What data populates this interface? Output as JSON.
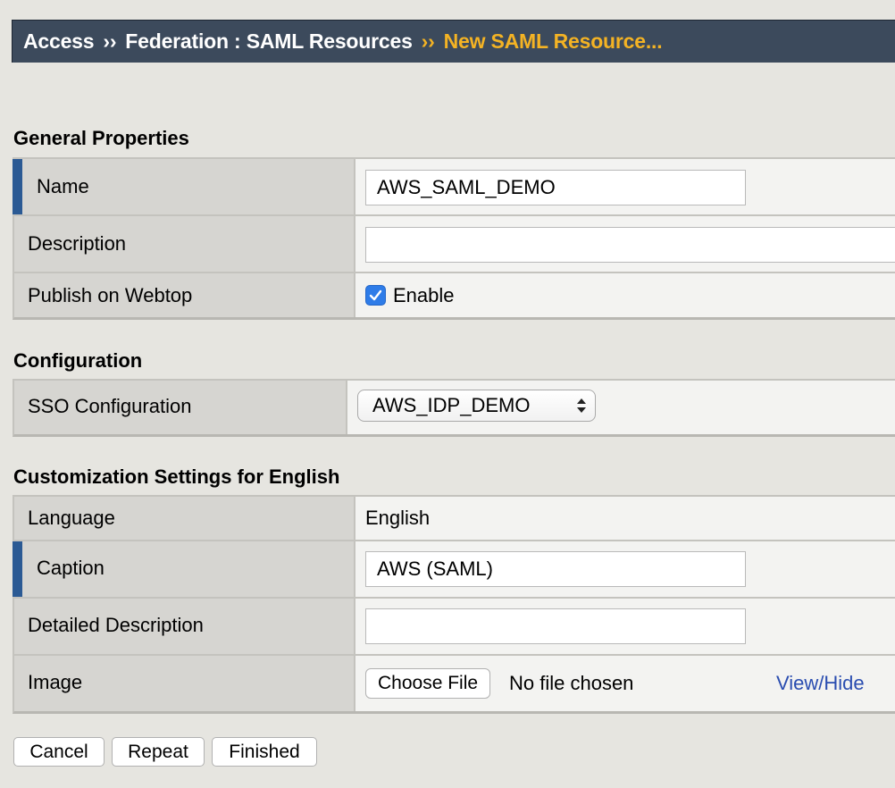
{
  "breadcrumb": {
    "items": [
      "Access",
      "Federation : SAML Resources"
    ],
    "separator": "››",
    "current": "New SAML Resource..."
  },
  "general": {
    "title": "General Properties",
    "name_label": "Name",
    "name_value": "AWS_SAML_DEMO",
    "description_label": "Description",
    "description_value": "",
    "publish_label": "Publish on Webtop",
    "publish_checkbox_label": "Enable",
    "publish_checked": true
  },
  "configuration": {
    "title": "Configuration",
    "sso_label": "SSO Configuration",
    "sso_value": "AWS_IDP_DEMO"
  },
  "customization": {
    "title": "Customization Settings for English",
    "language_label": "Language",
    "language_value": "English",
    "caption_label": "Caption",
    "caption_value": "AWS (SAML)",
    "detailed_description_label": "Detailed Description",
    "detailed_description_value": "",
    "image_label": "Image",
    "choose_file_label": "Choose File",
    "file_status": "No file chosen",
    "view_hide_link": "View/Hide"
  },
  "actions": {
    "cancel": "Cancel",
    "repeat": "Repeat",
    "finished": "Finished"
  },
  "colors": {
    "header_bg": "#3c4a5c",
    "header_current": "#f4b324",
    "required_marker": "#2b5a94",
    "link": "#2a4db0",
    "checkbox": "#2e7ce8"
  }
}
